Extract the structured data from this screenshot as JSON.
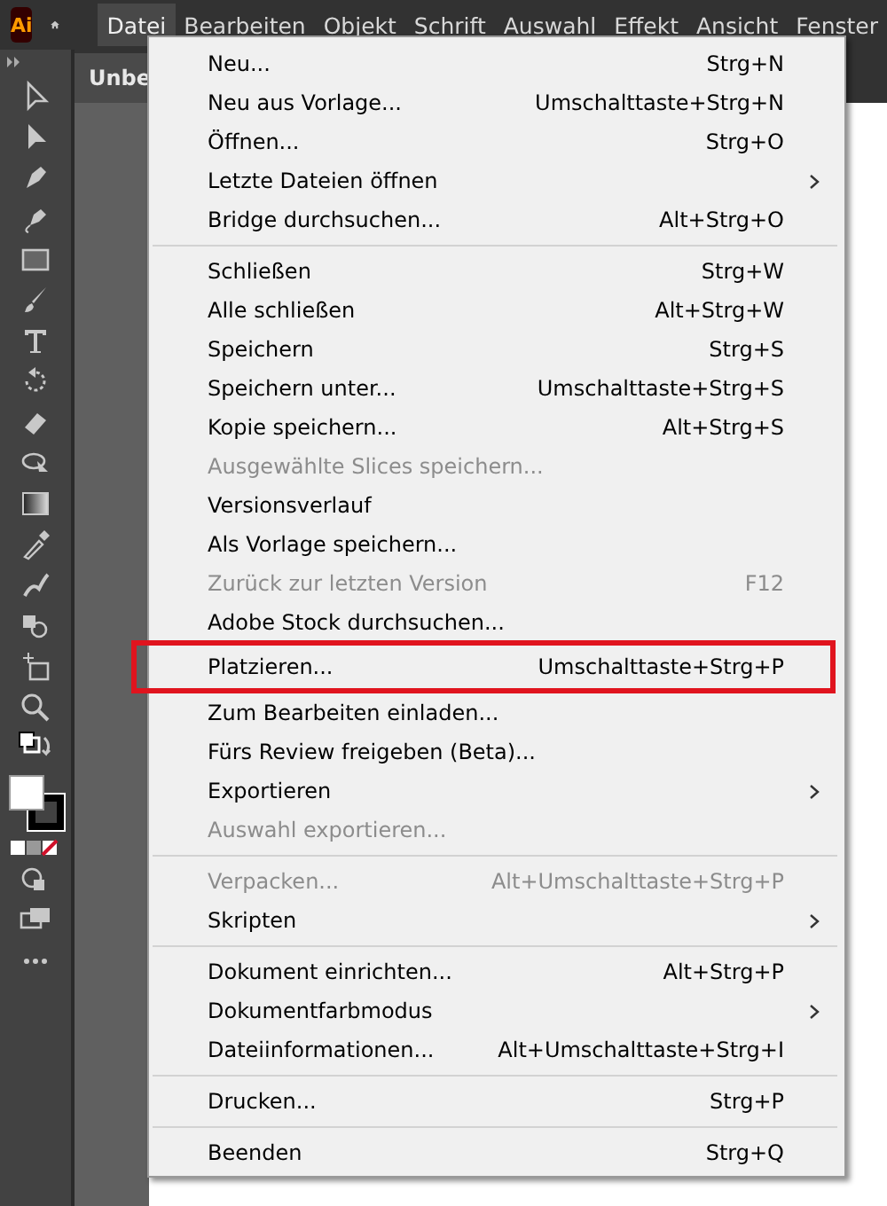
{
  "menu_bar": [
    {
      "label": "Datei",
      "selected": true
    },
    {
      "label": "Bearbeiten",
      "selected": false
    },
    {
      "label": "Objekt",
      "selected": false
    },
    {
      "label": "Schrift",
      "selected": false
    },
    {
      "label": "Auswahl",
      "selected": false
    },
    {
      "label": "Effekt",
      "selected": false
    },
    {
      "label": "Ansicht",
      "selected": false
    },
    {
      "label": "Fenster",
      "selected": false
    }
  ],
  "app_logo": "Ai",
  "document_tab": {
    "title": "Unbe"
  },
  "menu": {
    "sections": [
      [
        {
          "label": "Neu...",
          "shortcut": "Strg+N",
          "submenu": false,
          "disabled": false,
          "highlighted": false
        },
        {
          "label": "Neu aus Vorlage...",
          "shortcut": "Umschalttaste+Strg+N",
          "submenu": false,
          "disabled": false,
          "highlighted": false
        },
        {
          "label": "Öffnen...",
          "shortcut": "Strg+O",
          "submenu": false,
          "disabled": false,
          "highlighted": false
        },
        {
          "label": "Letzte Dateien öffnen",
          "submenu": true,
          "disabled": false,
          "highlighted": false
        },
        {
          "label": "Bridge durchsuchen...",
          "shortcut": "Alt+Strg+O",
          "submenu": false,
          "disabled": false,
          "highlighted": false
        }
      ],
      [
        {
          "label": "Schließen",
          "shortcut": "Strg+W",
          "submenu": false,
          "disabled": false,
          "highlighted": false
        },
        {
          "label": "Alle schließen",
          "shortcut": "Alt+Strg+W",
          "submenu": false,
          "disabled": false,
          "highlighted": false
        },
        {
          "label": "Speichern",
          "shortcut": "Strg+S",
          "submenu": false,
          "disabled": false,
          "highlighted": false
        },
        {
          "label": "Speichern unter...",
          "shortcut": "Umschalttaste+Strg+S",
          "submenu": false,
          "disabled": false,
          "highlighted": false
        },
        {
          "label": "Kopie speichern...",
          "shortcut": "Alt+Strg+S",
          "submenu": false,
          "disabled": false,
          "highlighted": false
        },
        {
          "label": "Ausgewählte Slices speichern...",
          "submenu": false,
          "disabled": true,
          "highlighted": false
        },
        {
          "label": "Versionsverlauf",
          "submenu": false,
          "disabled": false,
          "highlighted": false
        },
        {
          "label": "Als Vorlage speichern...",
          "submenu": false,
          "disabled": false,
          "highlighted": false
        },
        {
          "label": "Zurück zur letzten Version",
          "shortcut": "F12",
          "submenu": false,
          "disabled": true,
          "highlighted": false
        },
        {
          "label": "Adobe Stock durchsuchen...",
          "submenu": false,
          "disabled": false,
          "highlighted": false
        },
        {
          "label": "Platzieren...",
          "shortcut": "Umschalttaste+Strg+P",
          "submenu": false,
          "disabled": false,
          "highlighted": true
        },
        {
          "label": "Zum Bearbeiten einladen...",
          "submenu": false,
          "disabled": false,
          "highlighted": false
        },
        {
          "label": "Fürs Review freigeben (Beta)...",
          "submenu": false,
          "disabled": false,
          "highlighted": false
        },
        {
          "label": "Exportieren",
          "submenu": true,
          "disabled": false,
          "highlighted": false
        },
        {
          "label": "Auswahl exportieren...",
          "submenu": false,
          "disabled": true,
          "highlighted": false
        }
      ],
      [
        {
          "label": "Verpacken...",
          "shortcut": "Alt+Umschalttaste+Strg+P",
          "submenu": false,
          "disabled": true,
          "highlighted": false
        },
        {
          "label": "Skripten",
          "submenu": true,
          "disabled": false,
          "highlighted": false
        }
      ],
      [
        {
          "label": "Dokument einrichten...",
          "shortcut": "Alt+Strg+P",
          "submenu": false,
          "disabled": false,
          "highlighted": false
        },
        {
          "label": "Dokumentfarbmodus",
          "submenu": true,
          "disabled": false,
          "highlighted": false
        },
        {
          "label": "Dateiinformationen...",
          "shortcut": "Alt+Umschalttaste+Strg+I",
          "submenu": false,
          "disabled": false,
          "highlighted": false
        }
      ],
      [
        {
          "label": "Drucken...",
          "shortcut": "Strg+P",
          "submenu": false,
          "disabled": false,
          "highlighted": false
        }
      ],
      [
        {
          "label": "Beenden",
          "shortcut": "Strg+Q",
          "submenu": false,
          "disabled": false,
          "highlighted": false
        }
      ]
    ]
  }
}
